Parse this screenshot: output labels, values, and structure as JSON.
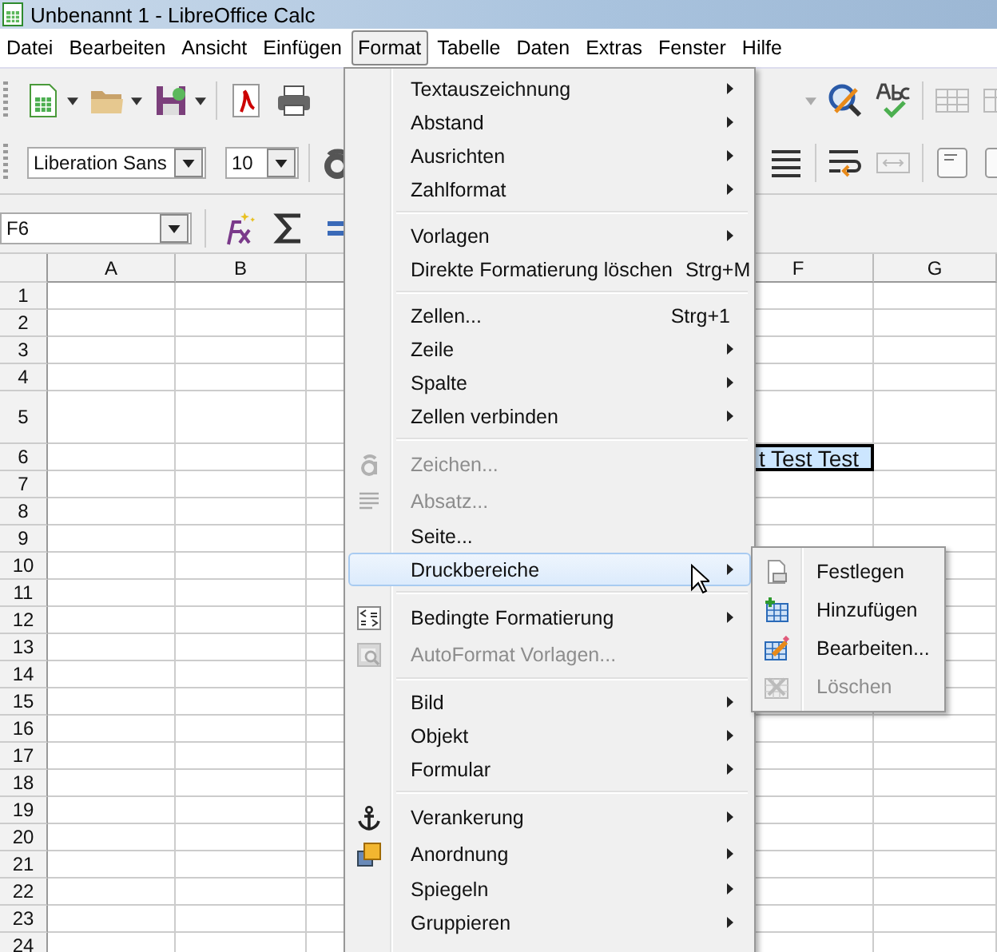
{
  "window": {
    "title": "Unbenannt 1 - LibreOffice Calc"
  },
  "menubar": [
    {
      "label": "Datei",
      "selected": false
    },
    {
      "label": "Bearbeiten",
      "selected": false
    },
    {
      "label": "Ansicht",
      "selected": false
    },
    {
      "label": "Einfügen",
      "selected": false
    },
    {
      "label": "Format",
      "selected": true
    },
    {
      "label": "Tabelle",
      "selected": false
    },
    {
      "label": "Daten",
      "selected": false
    },
    {
      "label": "Extras",
      "selected": false
    },
    {
      "label": "Fenster",
      "selected": false
    },
    {
      "label": "Hilfe",
      "selected": false
    }
  ],
  "formatting": {
    "font_name": "Liberation Sans",
    "font_size": "10"
  },
  "formula_bar": {
    "name_box": "F6"
  },
  "sheet": {
    "columns": [
      "A",
      "B",
      "F",
      "G"
    ],
    "rows": [
      {
        "header": "1"
      },
      {
        "header": "2"
      },
      {
        "header": "3"
      },
      {
        "header": "4"
      },
      {
        "header": "5"
      },
      {
        "header": "6",
        "cell_f": {
          "text": "t Test Test",
          "selected": true
        }
      },
      {
        "header": "7"
      },
      {
        "header": "8"
      },
      {
        "header": "9"
      },
      {
        "header": "10"
      },
      {
        "header": "11"
      },
      {
        "header": "12"
      },
      {
        "header": "13"
      },
      {
        "header": "14"
      },
      {
        "header": "15"
      },
      {
        "header": "16"
      },
      {
        "header": "17"
      },
      {
        "header": "18"
      },
      {
        "header": "19"
      },
      {
        "header": "20"
      },
      {
        "header": "21"
      },
      {
        "header": "22"
      },
      {
        "header": "23"
      },
      {
        "header": "24"
      }
    ]
  },
  "menu": {
    "items": [
      {
        "kind": "item",
        "label": "Textauszeichnung",
        "submenu": true,
        "disabled": false,
        "selected": false
      },
      {
        "kind": "item",
        "label": "Abstand",
        "submenu": true,
        "disabled": false,
        "selected": false
      },
      {
        "kind": "item",
        "label": "Ausrichten",
        "submenu": true,
        "disabled": false,
        "selected": false
      },
      {
        "kind": "item",
        "label": "Zahlformat",
        "submenu": true,
        "disabled": false,
        "selected": false
      },
      {
        "kind": "separator"
      },
      {
        "kind": "item",
        "label": "Vorlagen",
        "submenu": true,
        "disabled": false,
        "selected": false
      },
      {
        "kind": "item",
        "label": "Direkte Formatierung löschen",
        "shortcut": "Strg+M",
        "submenu": false,
        "disabled": false,
        "selected": false
      },
      {
        "kind": "separator"
      },
      {
        "kind": "item",
        "label": "Zellen...",
        "shortcut": "Strg+1",
        "submenu": false,
        "disabled": false,
        "selected": false
      },
      {
        "kind": "item",
        "label": "Zeile",
        "submenu": true,
        "disabled": false,
        "selected": false
      },
      {
        "kind": "item",
        "label": "Spalte",
        "submenu": true,
        "disabled": false,
        "selected": false
      },
      {
        "kind": "item",
        "label": "Zellen verbinden",
        "submenu": true,
        "disabled": false,
        "selected": false
      },
      {
        "kind": "separator"
      },
      {
        "kind": "item",
        "label": "Zeichen...",
        "submenu": false,
        "disabled": true,
        "selected": false
      },
      {
        "kind": "item",
        "label": "Absatz...",
        "submenu": false,
        "disabled": true,
        "selected": false
      },
      {
        "kind": "item",
        "label": "Seite...",
        "submenu": false,
        "disabled": false,
        "selected": false
      },
      {
        "kind": "item",
        "label": "Druckbereiche",
        "submenu": true,
        "disabled": false,
        "selected": true
      },
      {
        "kind": "separator"
      },
      {
        "kind": "item",
        "label": "Bedingte Formatierung",
        "submenu": true,
        "disabled": false,
        "selected": false
      },
      {
        "kind": "item",
        "label": "AutoFormat Vorlagen...",
        "submenu": false,
        "disabled": true,
        "selected": false
      },
      {
        "kind": "separator"
      },
      {
        "kind": "item",
        "label": "Bild",
        "submenu": true,
        "disabled": false,
        "selected": false
      },
      {
        "kind": "item",
        "label": "Objekt",
        "submenu": true,
        "disabled": false,
        "selected": false
      },
      {
        "kind": "item",
        "label": "Formular",
        "submenu": true,
        "disabled": false,
        "selected": false
      },
      {
        "kind": "separator"
      },
      {
        "kind": "item",
        "label": "Verankerung",
        "submenu": true,
        "disabled": false,
        "selected": false
      },
      {
        "kind": "item",
        "label": "Anordnung",
        "submenu": true,
        "disabled": false,
        "selected": false
      },
      {
        "kind": "item",
        "label": "Spiegeln",
        "submenu": true,
        "disabled": false,
        "selected": false
      },
      {
        "kind": "item",
        "label": "Gruppieren",
        "submenu": true,
        "disabled": false,
        "selected": false
      }
    ]
  },
  "submenu": {
    "items": [
      {
        "label": "Festlegen",
        "disabled": false
      },
      {
        "label": "Hinzufügen",
        "disabled": false
      },
      {
        "label": "Bearbeiten...",
        "disabled": false
      },
      {
        "label": "Löschen",
        "disabled": true
      }
    ]
  }
}
